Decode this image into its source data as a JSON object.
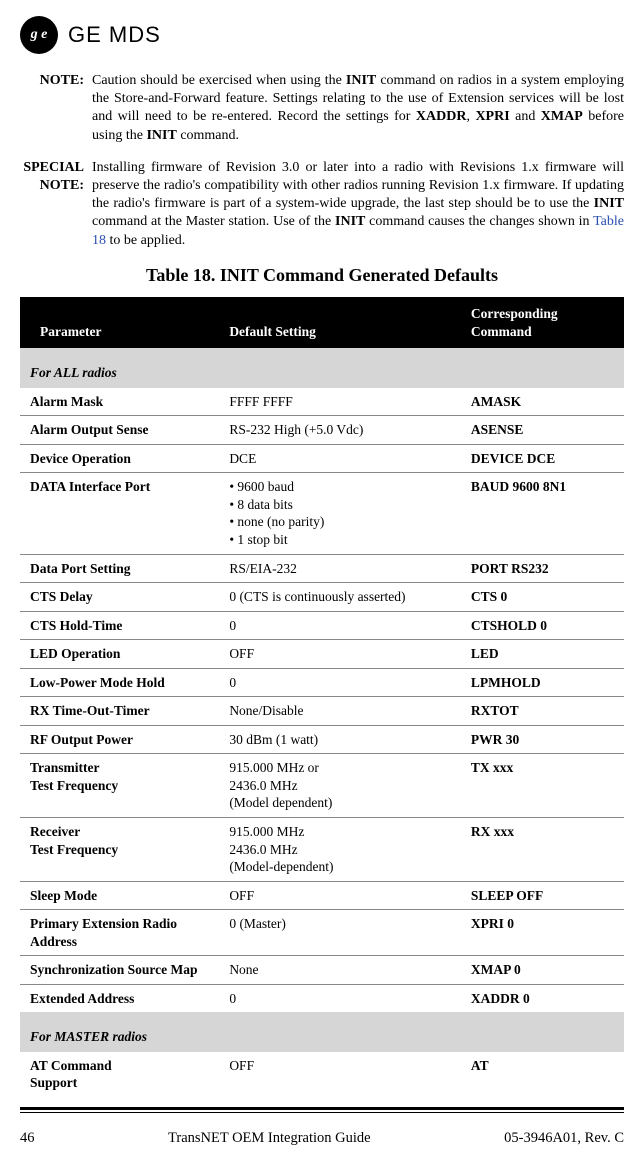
{
  "logo": {
    "monogram": "g e",
    "brand": "GE MDS"
  },
  "notes": {
    "n1_label": "NOTE:",
    "n1_html": "Caution should be exercised when using the <b>INIT</b> command on radios in a system employing the Store-and-Forward feature. Settings relating to the use of Extension services will be lost and will need to be re-entered. Record the settings for <b>XADDR</b>, <b>XPRI</b> and <b>XMAP</b> before using the <b>INIT</b> command.",
    "n2_label": "SPECIAL\nNOTE:",
    "n2_html": "Installing firmware of Revision 3.0 or later into a radio with Revisions 1.x firmware will preserve the radio's compatibility with other radios running Revision 1.x firmware. If updating the radio's firmware is part of a system-wide upgrade, the last step should be to use the <b>INIT</b> command at the Master station. Use of the <b>INIT</b> command causes the changes shown in <span class='table-ref'>Table 18</span> to be applied."
  },
  "table": {
    "title": "Table 18. INIT Command Generated Defaults",
    "headers": {
      "c1": "Parameter",
      "c2": "Default Setting",
      "c3": "Corresponding Command"
    },
    "section_all": "For ALL radios",
    "section_master": "For MASTER radios",
    "rows_all": [
      {
        "p": "Alarm Mask",
        "d": "FFFF FFFF",
        "c": "AMASK"
      },
      {
        "p": "Alarm Output Sense",
        "d": "RS-232 High (+5.0 Vdc)",
        "c": "ASENSE"
      },
      {
        "p": "Device Operation",
        "d": "DCE",
        "c": "DEVICE DCE"
      },
      {
        "p": "DATA Interface Port",
        "d": "• 9600 baud\n• 8 data bits\n• none (no parity)\n• 1 stop bit",
        "c": "BAUD 9600 8N1"
      },
      {
        "p": "Data Port Setting",
        "d": "RS/EIA-232",
        "c": "PORT RS232"
      },
      {
        "p": "CTS Delay",
        "d": "0 (CTS is continuously asserted)",
        "c": "CTS 0"
      },
      {
        "p": "CTS Hold-Time",
        "d": "0",
        "c": "CTSHOLD 0"
      },
      {
        "p": "LED Operation",
        "d": "OFF",
        "c": "LED"
      },
      {
        "p": "Low-Power Mode Hold",
        "d": "0",
        "c": "LPMHOLD"
      },
      {
        "p": "RX Time-Out-Timer",
        "d": "None/Disable",
        "c": "RXTOT"
      },
      {
        "p": "RF Output Power",
        "d": "30 dBm (1 watt)",
        "c": "PWR 30"
      },
      {
        "p": "Transmitter\nTest Frequency",
        "d": "915.000 MHz or\n2436.0 MHz\n(Model dependent)",
        "c": "TX xxx"
      },
      {
        "p": "Receiver\nTest Frequency",
        "d": "915.000 MHz\n2436.0 MHz\n(Model-dependent)",
        "c": "RX xxx"
      },
      {
        "p": "Sleep Mode",
        "d": "OFF",
        "c": "SLEEP OFF"
      },
      {
        "p": "Primary Extension Radio Address",
        "d": "0 (Master)",
        "c": "XPRI 0"
      },
      {
        "p": "Synchronization Source Map",
        "d": "None",
        "c": "XMAP 0"
      },
      {
        "p": "Extended Address",
        "d": "0",
        "c": "XADDR 0"
      }
    ],
    "rows_master": [
      {
        "p": "AT Command\nSupport",
        "d": "OFF",
        "c": "AT"
      }
    ]
  },
  "footer": {
    "page": "46",
    "title": "TransNET OEM Integration Guide",
    "docnum": "05-3946A01, Rev. C"
  }
}
